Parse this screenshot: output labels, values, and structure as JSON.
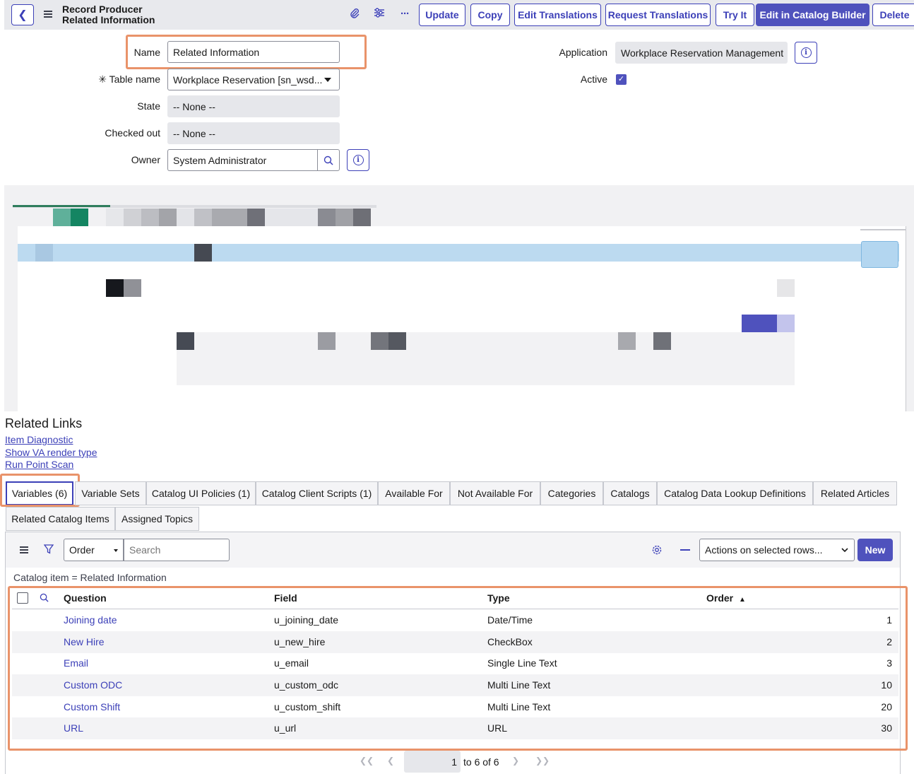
{
  "header": {
    "title_line1": "Record Producer",
    "title_line2": "Related Information",
    "buttons": {
      "update": "Update",
      "copy": "Copy",
      "edit_translations": "Edit Translations",
      "request_translations": "Request Translations",
      "try_it": "Try It",
      "edit_catalog_builder": "Edit in Catalog Builder",
      "delete": "Delete"
    },
    "icons": {
      "back": "chevron-left-icon",
      "menu": "hamburger-icon",
      "attach": "paperclip-icon",
      "settings": "sliders-icon",
      "more": "ellipsis-icon"
    }
  },
  "form": {
    "name_label": "Name",
    "name_value": "Related Information",
    "table_label": "Table name",
    "table_required": "✳",
    "table_value": "Workplace Reservation [sn_wsd...",
    "state_label": "State",
    "state_value": "-- None --",
    "checked_out_label": "Checked out",
    "checked_out_value": "-- None --",
    "owner_label": "Owner",
    "owner_value": "System Administrator",
    "application_label": "Application",
    "application_value": "Workplace Reservation Management",
    "active_label": "Active",
    "active_checked": true
  },
  "related_links": {
    "title": "Related Links",
    "links": [
      "Item Diagnostic",
      "Show VA render type",
      "Run Point Scan"
    ]
  },
  "tabs": {
    "row1": [
      "Variables (6)",
      "Variable Sets",
      "Catalog UI Policies (1)",
      "Catalog Client Scripts (1)",
      "Available For",
      "Not Available For",
      "Categories",
      "Catalogs",
      "Catalog Data Lookup Definitions",
      "Related Articles"
    ],
    "row2": [
      "Related Catalog Items",
      "Assigned Topics"
    ],
    "active": "Variables (6)"
  },
  "list": {
    "search_field": "Order",
    "search_placeholder": "Search",
    "actions_select": "Actions on selected rows...",
    "new_button": "New",
    "breadcrumb": "Catalog item = Related Information",
    "columns": {
      "question": "Question",
      "field": "Field",
      "type": "Type",
      "order": "Order"
    },
    "sort_indicator": "▲",
    "rows": [
      {
        "question": "Joining date",
        "field": "u_joining_date",
        "type": "Date/Time",
        "order": "1"
      },
      {
        "question": "New Hire",
        "field": "u_new_hire",
        "type": "CheckBox",
        "order": "2"
      },
      {
        "question": "Email",
        "field": "u_email",
        "type": "Single Line Text",
        "order": "3"
      },
      {
        "question": "Custom ODC",
        "field": "u_custom_odc",
        "type": "Multi Line Text",
        "order": "10"
      },
      {
        "question": "Custom Shift",
        "field": "u_custom_shift",
        "type": "Multi Line Text",
        "order": "20"
      },
      {
        "question": "URL",
        "field": "u_url",
        "type": "URL",
        "order": "30"
      }
    ],
    "pager": {
      "current": "1",
      "range_text": "to 6 of 6"
    }
  },
  "colors": {
    "accent": "#3c40b8",
    "primary_button": "#4f52bd",
    "highlight": "#e9936a"
  }
}
